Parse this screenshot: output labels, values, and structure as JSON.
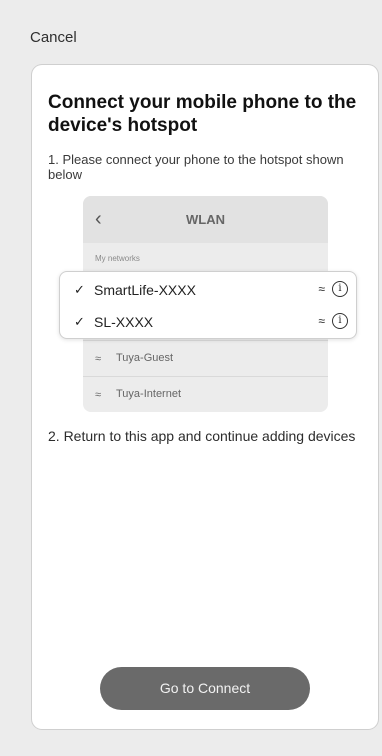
{
  "header": {
    "cancel_label": "Cancel"
  },
  "card": {
    "title": "Connect your mobile phone to the device's hotspot",
    "step1": "1. Please connect your phone to the hotspot shown below",
    "step2": "2. Return to this app and continue adding devices",
    "button_label": "Go to Connect"
  },
  "wlan": {
    "title": "WLAN",
    "back_icon": "chevron-left-icon",
    "section_label": "My networks",
    "selected_networks": [
      {
        "name": "SmartLife-XXXX",
        "check_icon": "checkmark-icon",
        "wifi_icon": "wifi-icon",
        "info_icon": "info-icon"
      },
      {
        "name": "SL-XXXX",
        "check_icon": "checkmark-icon",
        "wifi_icon": "wifi-icon",
        "info_icon": "info-icon"
      }
    ],
    "other_networks": [
      {
        "name": "Tuya-Guest",
        "wifi_icon": "wifi-icon"
      },
      {
        "name": "Tuya-Internet",
        "wifi_icon": "wifi-icon"
      }
    ]
  },
  "colors": {
    "background": "#ececec",
    "card": "#ffffff",
    "button": "#6a6a6a",
    "button_text": "#f2f2f2"
  }
}
